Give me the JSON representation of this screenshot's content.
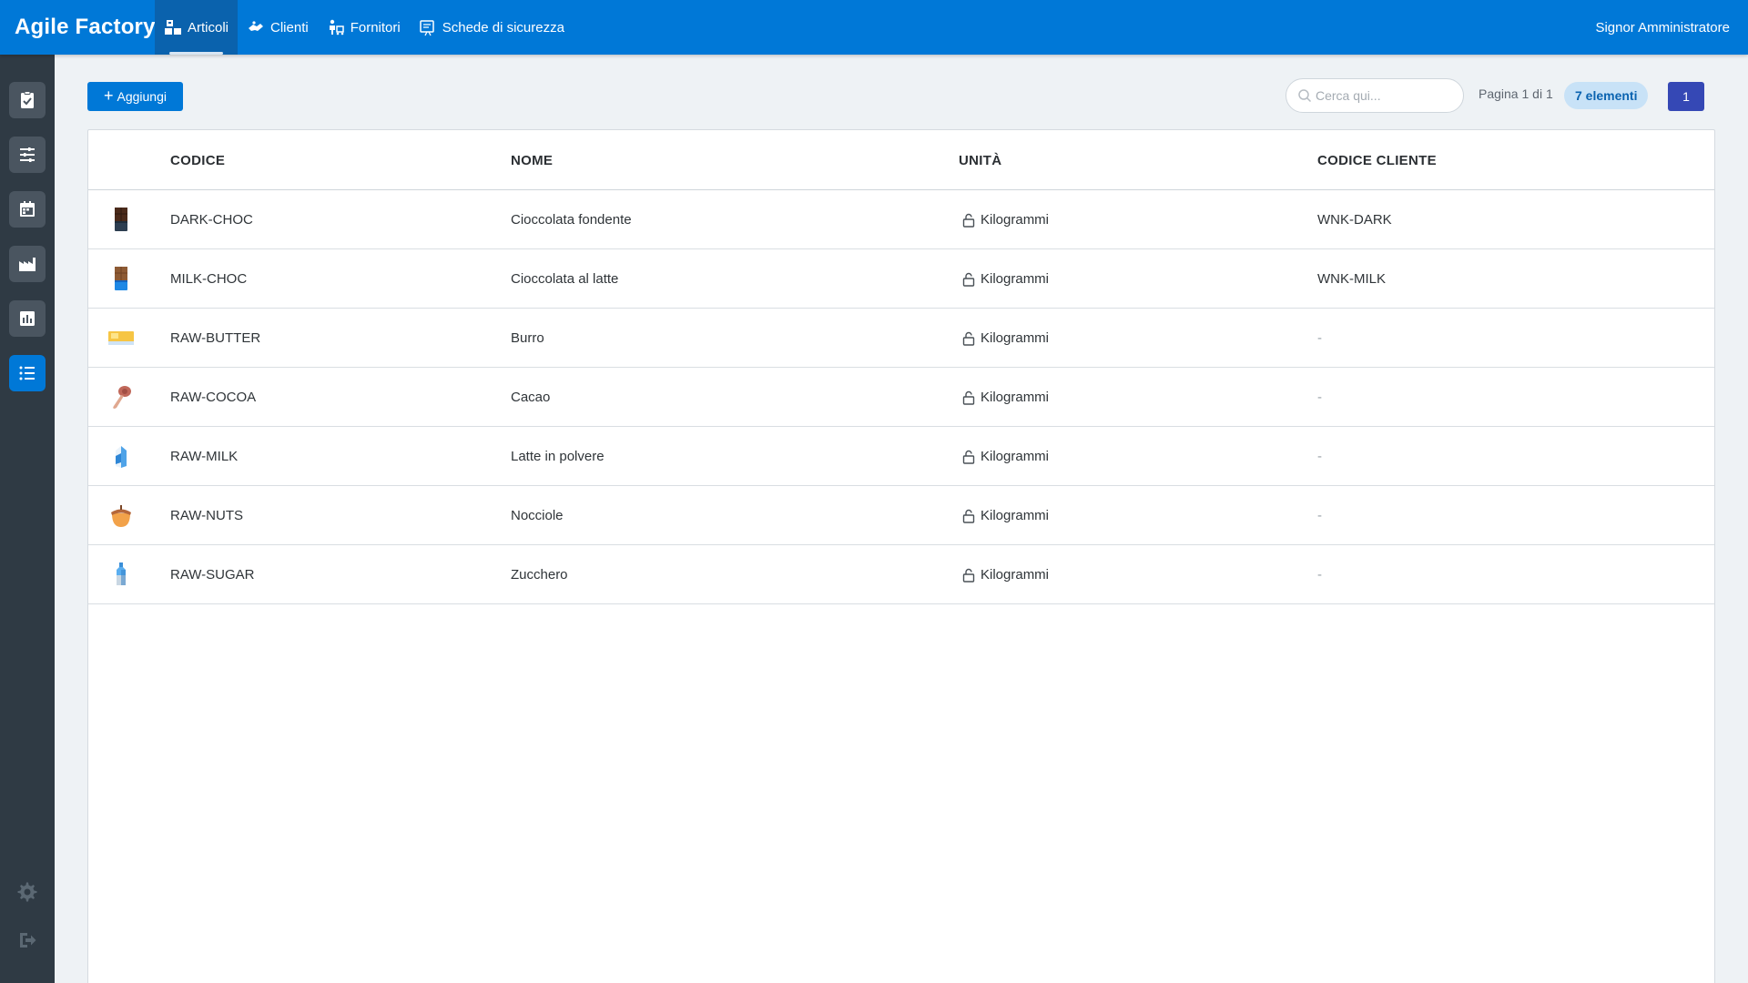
{
  "app": {
    "brand": "Agile Factory",
    "user": "Signor Amministratore"
  },
  "topnav": [
    {
      "label": "Articoli",
      "icon": "boxes-icon",
      "active": true
    },
    {
      "label": "Clienti",
      "icon": "handshake-icon",
      "active": false
    },
    {
      "label": "Fornitori",
      "icon": "delivery-person-icon",
      "active": false
    },
    {
      "label": "Schede di sicurezza",
      "icon": "safety-sheet-icon",
      "active": false
    }
  ],
  "sidebar": {
    "items": [
      {
        "icon": "clipboard-check-icon"
      },
      {
        "icon": "sliders-icon"
      },
      {
        "icon": "calendar-icon"
      },
      {
        "icon": "factory-icon"
      },
      {
        "icon": "bar-chart-icon"
      },
      {
        "icon": "list-icon",
        "active": true
      }
    ],
    "bottom": [
      {
        "icon": "gear-icon"
      },
      {
        "icon": "logout-icon"
      }
    ]
  },
  "toolbar": {
    "add_label": "Aggiungi",
    "search_placeholder": "Cerca qui...",
    "page_info": "Pagina 1 di 1",
    "count_badge": "7 elementi",
    "page_number": "1"
  },
  "table": {
    "columns": [
      "CODICE",
      "NOME",
      "UNITÀ",
      "CODICE CLIENTE"
    ],
    "rows": [
      {
        "icon": "dark-chocolate-icon",
        "code": "DARK-CHOC",
        "name": "Cioccolata fondente",
        "unit": "Kilogrammi",
        "client_code": "WNK-DARK"
      },
      {
        "icon": "milk-chocolate-icon",
        "code": "MILK-CHOC",
        "name": "Cioccolata al latte",
        "unit": "Kilogrammi",
        "client_code": "WNK-MILK"
      },
      {
        "icon": "butter-icon",
        "code": "RAW-BUTTER",
        "name": "Burro",
        "unit": "Kilogrammi",
        "client_code": "-"
      },
      {
        "icon": "cocoa-icon",
        "code": "RAW-COCOA",
        "name": "Cacao",
        "unit": "Kilogrammi",
        "client_code": "-"
      },
      {
        "icon": "milk-carton-icon",
        "code": "RAW-MILK",
        "name": "Latte in polvere",
        "unit": "Kilogrammi",
        "client_code": "-"
      },
      {
        "icon": "hazelnut-icon",
        "code": "RAW-NUTS",
        "name": "Nocciole",
        "unit": "Kilogrammi",
        "client_code": "-"
      },
      {
        "icon": "sugar-bottle-icon",
        "code": "RAW-SUGAR",
        "name": "Zucchero",
        "unit": "Kilogrammi",
        "client_code": "-"
      }
    ]
  },
  "colors": {
    "primary": "#0078d7",
    "sidebar": "#2f3a44",
    "page_button": "#3548b5",
    "badge_bg": "#c8e2f7"
  }
}
